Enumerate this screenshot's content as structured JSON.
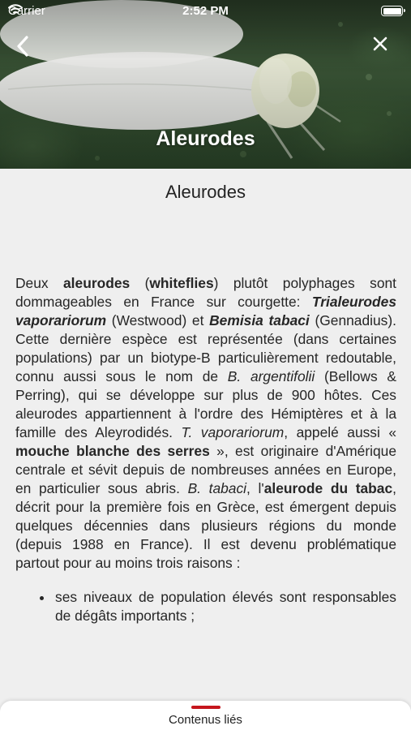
{
  "status_bar": {
    "carrier": "Carrier",
    "time": "2:52 PM"
  },
  "header": {
    "title": "Aleurodes",
    "back_icon": "chevron-left-icon",
    "close_icon": "close-icon"
  },
  "page": {
    "title": "Aleurodes"
  },
  "article": {
    "p1": {
      "t1": "Deux ",
      "b1": "aleurodes",
      "t2": " (",
      "b2": "whiteflies",
      "t3": ") plutôt polyphages sont dommageables en France sur courgette: ",
      "bi1": "Trialeurodes vaporariorum",
      "t4": " (Westwood) et ",
      "bi2": "Bemisia tabaci",
      "t5": " (Gennadius). Cette dernière espèce est représentée (dans certaines populations) par un biotype-B particulièrement redoutable, connu aussi sous le nom de ",
      "i1": "B. argentifolii",
      "t6": " (Bellows & Perring), qui se développe sur plus de 900 hôtes. Ces aleurodes appartiennent à l'ordre des Hémiptères et à la famille des Aleyrodidés. ",
      "i2": "T. vaporariorum",
      "t7": ", appelé aussi « ",
      "b3": "mouche blanche des serres",
      "t8": " », est originaire d'Amérique centrale et sévit depuis de nombreuses années en Europe, en particulier sous abris. ",
      "i3": "B. tabaci",
      "t9": ", l'",
      "b4": "aleurode du tabac",
      "t10": ", décrit pour la première fois en Grèce, est émergent depuis quelques décennies dans plusieurs régions du monde (depuis 1988 en France). Il est devenu problématique partout pour au moins trois raisons :"
    },
    "bullets": [
      "ses niveaux de population élevés sont responsables de dégâts importants ;"
    ]
  },
  "bottom_sheet": {
    "label": "Contenus liés"
  },
  "colors": {
    "accent": "#c5161d",
    "background": "#efefef"
  }
}
